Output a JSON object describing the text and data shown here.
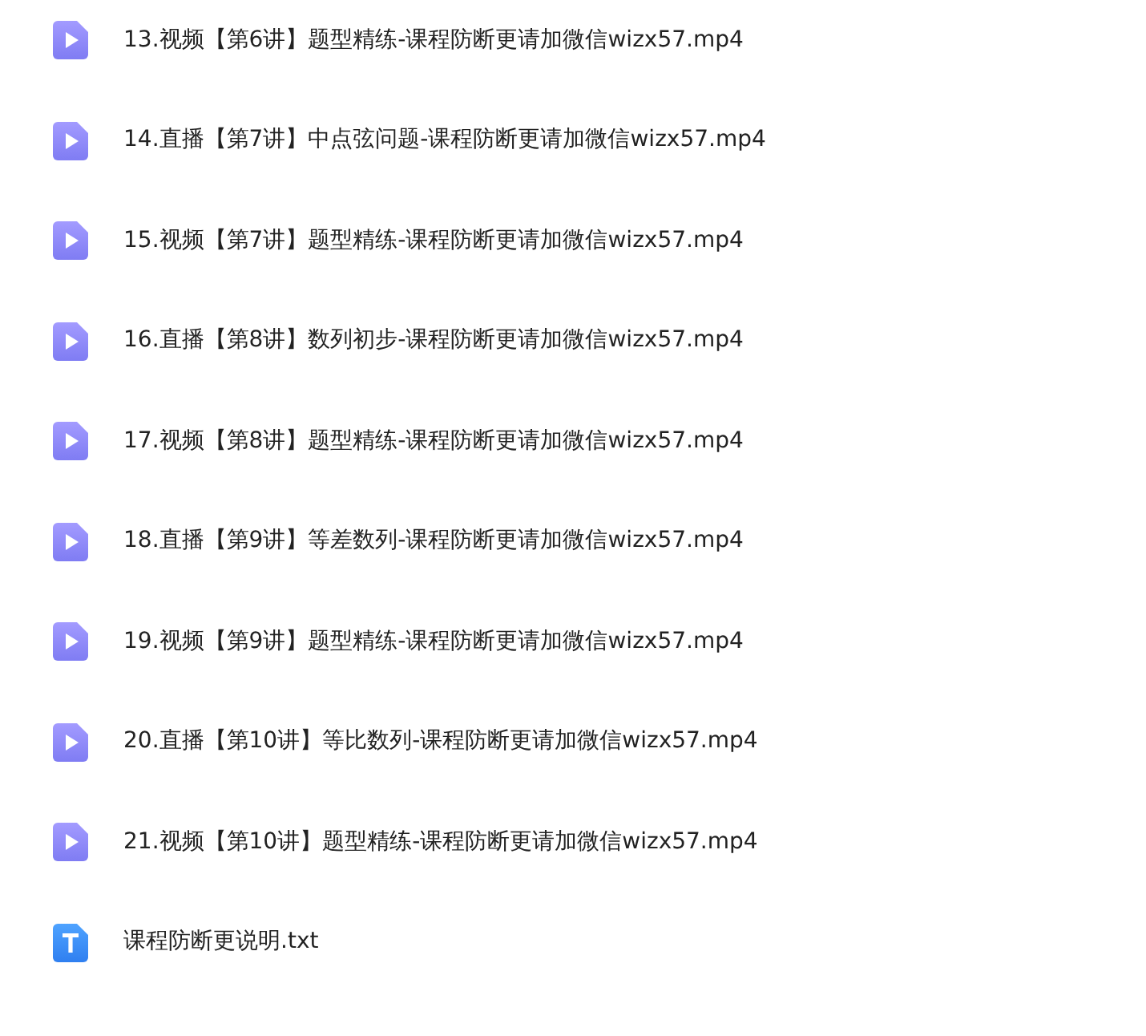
{
  "files": [
    {
      "kind": "video",
      "name": "13.视频【第6讲】题型精练-课程防断更请加微信wizx57.mp4"
    },
    {
      "kind": "video",
      "name": "14.直播【第7讲】中点弦问题-课程防断更请加微信wizx57.mp4"
    },
    {
      "kind": "video",
      "name": "15.视频【第7讲】题型精练-课程防断更请加微信wizx57.mp4"
    },
    {
      "kind": "video",
      "name": "16.直播【第8讲】数列初步-课程防断更请加微信wizx57.mp4"
    },
    {
      "kind": "video",
      "name": "17.视频【第8讲】题型精练-课程防断更请加微信wizx57.mp4"
    },
    {
      "kind": "video",
      "name": "18.直播【第9讲】等差数列-课程防断更请加微信wizx57.mp4"
    },
    {
      "kind": "video",
      "name": "19.视频【第9讲】题型精练-课程防断更请加微信wizx57.mp4"
    },
    {
      "kind": "video",
      "name": "20.直播【第10讲】等比数列-课程防断更请加微信wizx57.mp4"
    },
    {
      "kind": "video",
      "name": "21.视频【第10讲】题型精练-课程防断更请加微信wizx57.mp4"
    },
    {
      "kind": "text",
      "name": "课程防断更说明.txt"
    }
  ]
}
